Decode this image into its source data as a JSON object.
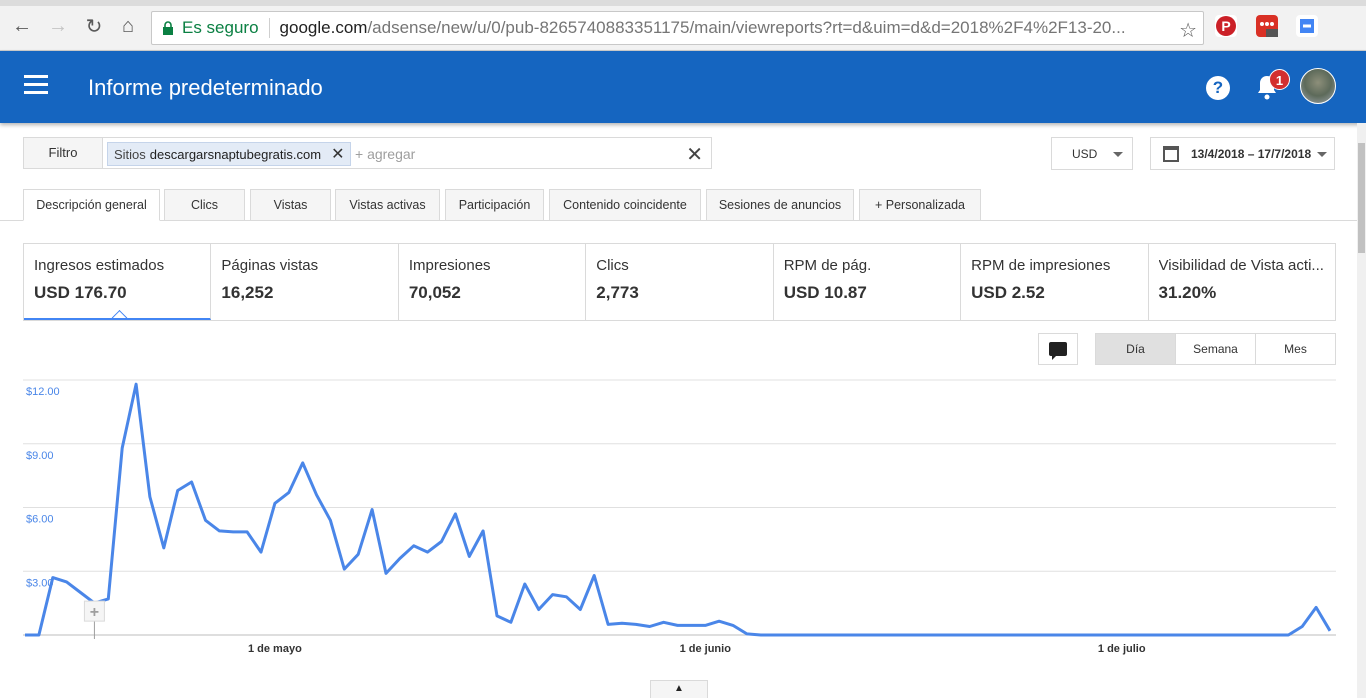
{
  "browser": {
    "secure_label": "Es seguro",
    "url_host": "google.com",
    "url_path": "/adsense/new/u/0/pub-8265740883351175/main/viewreports?rt=d&uim=d&d=2018%2F4%2F13-20..."
  },
  "appbar": {
    "title": "Informe predeterminado",
    "help_glyph": "?",
    "notification_count": "1"
  },
  "filter": {
    "button_label": "Filtro",
    "chip_prefix": "Sitios",
    "chip_value": "descargarsnaptubegratis.com",
    "add_placeholder": "+ agregar"
  },
  "currency": {
    "selected": "USD"
  },
  "date_range": {
    "value": "13/4/2018 – 17/7/2018"
  },
  "tabs": [
    {
      "label": "Descripción general"
    },
    {
      "label": "Clics"
    },
    {
      "label": "Vistas"
    },
    {
      "label": "Vistas activas"
    },
    {
      "label": "Participación"
    },
    {
      "label": "Contenido coincidente"
    },
    {
      "label": "Sesiones de anuncios"
    },
    {
      "label": "+ Personalizada"
    }
  ],
  "metrics": [
    {
      "label": "Ingresos estimados",
      "value": "USD 176.70"
    },
    {
      "label": "Páginas vistas",
      "value": "16,252"
    },
    {
      "label": "Impresiones",
      "value": "70,052"
    },
    {
      "label": "Clics",
      "value": "2,773"
    },
    {
      "label": "RPM de pág.",
      "value": "USD 10.87"
    },
    {
      "label": "RPM de impresiones",
      "value": "USD 2.52"
    },
    {
      "label": "Visibilidad de Vista acti...",
      "value": "31.20%"
    }
  ],
  "granularity": {
    "options": [
      "Día",
      "Semana",
      "Mes"
    ],
    "selected": "Día"
  },
  "colors": {
    "appbar": "#1565c0",
    "line": "#4a86e8",
    "grid": "#e0e0e0"
  },
  "chart_data": {
    "type": "line",
    "ylabel": "",
    "ylim": [
      0,
      12
    ],
    "y_ticks": [
      "$12.00",
      "$9.00",
      "$6.00",
      "$3.00"
    ],
    "x_ticks": [
      "1 de mayo",
      "1 de junio",
      "1 de julio"
    ],
    "series": [
      {
        "values": [
          0,
          0,
          2.7,
          2.5,
          2.0,
          1.5,
          1.7,
          8.8,
          11.8,
          6.5,
          4.1,
          6.8,
          7.2,
          5.4,
          4.9,
          4.85,
          4.85,
          3.9,
          6.2,
          6.7,
          8.1,
          6.6,
          5.4,
          3.1,
          3.8,
          5.9,
          2.9,
          3.6,
          4.2,
          3.9,
          4.4,
          5.7,
          3.7,
          4.9,
          0.9,
          0.6,
          2.4,
          1.2,
          1.9,
          1.8,
          1.2,
          2.8,
          0.5,
          0.55,
          0.5,
          0.4,
          0.6,
          0.45,
          0.45,
          0.45,
          0.65,
          0.45,
          0.05,
          0,
          0,
          0,
          0,
          0,
          0,
          0,
          0,
          0,
          0,
          0,
          0,
          0,
          0,
          0,
          0,
          0,
          0,
          0,
          0,
          0,
          0,
          0,
          0,
          0,
          0,
          0,
          0,
          0,
          0,
          0,
          0,
          0,
          0,
          0,
          0,
          0,
          0,
          0,
          0.4,
          1.3,
          0.2
        ]
      }
    ]
  }
}
